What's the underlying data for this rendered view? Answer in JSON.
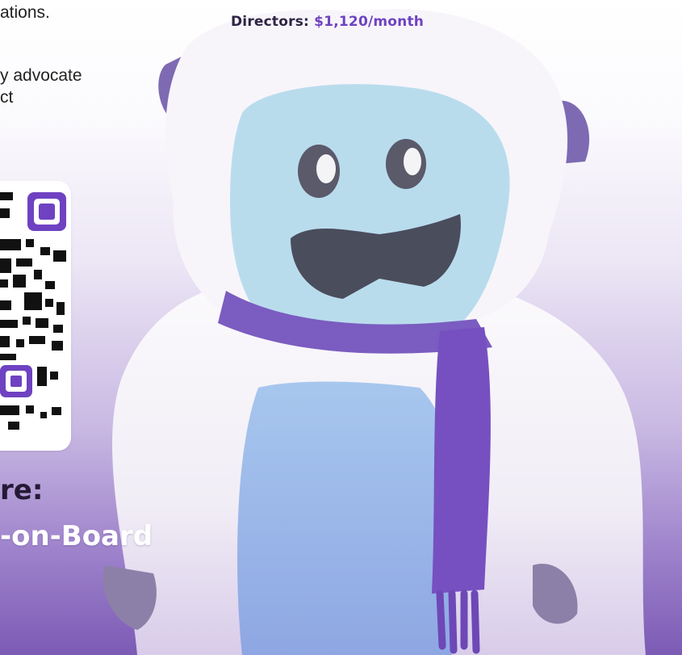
{
  "body_text": {
    "line1": "ations.",
    "line2": "y advocate",
    "line3": "ct"
  },
  "directors": {
    "label": "Directors:",
    "price": "$1,120/month"
  },
  "cta": {
    "line1": "re:",
    "line2": "-on-Board"
  },
  "colors": {
    "accent_purple": "#6f42c1",
    "scarf_purple": "#7b5cc0",
    "face_blue": "#b9dced",
    "fur_white": "#f6f4f8"
  },
  "images": {
    "qr_code": "qr-code-icon",
    "mascot": "yeti-mascot-image"
  }
}
